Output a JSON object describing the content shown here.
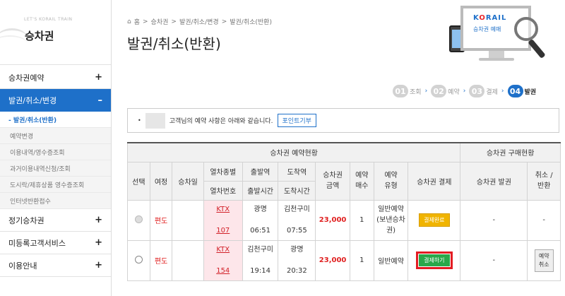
{
  "sidebar": {
    "tagline": "LET'S KORAIL TRAIN",
    "title": "승차권",
    "items": [
      {
        "label": "승차권예약",
        "mark": "+"
      },
      {
        "label": "발권/취소/변경",
        "mark": "–"
      },
      {
        "label": "정기승차권",
        "mark": "+"
      },
      {
        "label": "미등록고객서비스",
        "mark": "+"
      },
      {
        "label": "이용안내",
        "mark": "+"
      }
    ],
    "subitems": [
      {
        "label": "- 발권/취소(반환)"
      },
      {
        "label": "예약변경"
      },
      {
        "label": "이용내역/영수증조회"
      },
      {
        "label": "과거이용내역신청/조회"
      },
      {
        "label": "도시락/제휴상품 영수증조회"
      },
      {
        "label": "인터넷반환접수"
      }
    ]
  },
  "breadcrumb": [
    "홈",
    ">",
    "승차권",
    ">",
    "발권/취소/변경",
    ">",
    "발권/취소(반환)"
  ],
  "page_title": "발권/취소(반환)",
  "promo": {
    "logo_pre": "K",
    "logo_o": "O",
    "logo_post": "RAIL",
    "sub": "승차권 예매"
  },
  "steps": [
    {
      "num": "01",
      "label": "조회"
    },
    {
      "num": "02",
      "label": "예약"
    },
    {
      "num": "03",
      "label": "결제"
    },
    {
      "num": "04",
      "label": "발권"
    }
  ],
  "notice": {
    "text": "고객님의 예약 사항은 아래와 같습니다.",
    "button": "포인트기부"
  },
  "table": {
    "group_left": "승차권 예약현황",
    "group_right": "승차권 구매현황",
    "headers": {
      "select": "선택",
      "trip": "여정",
      "date": "승차일",
      "train_type": "열차종별",
      "train_no": "열차번호",
      "dep_station": "출발역",
      "dep_time": "출발시간",
      "arr_station": "도착역",
      "arr_time": "도착시간",
      "fare_1": "승차권",
      "fare_2": "금액",
      "count_1": "예약",
      "count_2": "매수",
      "type_1": "예약",
      "type_2": "유형",
      "pay": "승차권 결제",
      "issue": "승차권 발권",
      "cancel_1": "취소 /",
      "cancel_2": "반환"
    },
    "rows": [
      {
        "trip": "편도",
        "train_type": "KTX",
        "train_no": "107",
        "dep_station": "광명",
        "dep_time": "06:51",
        "arr_station": "김천구미",
        "arr_time": "07:55",
        "fare": "23,000",
        "count": "1",
        "type_1": "일반예약",
        "type_2": "(보낸승차",
        "type_3": "권)",
        "pay": "결제완료",
        "issue": "-",
        "cancel": "-"
      },
      {
        "trip": "편도",
        "train_type": "KTX",
        "train_no": "154",
        "dep_station": "김천구미",
        "dep_time": "19:14",
        "arr_station": "광명",
        "arr_time": "20:32",
        "fare": "23,000",
        "count": "1",
        "type_1": "일반예약",
        "pay": "결제하기",
        "issue": "-",
        "cancel_1": "예약",
        "cancel_2": "취소"
      }
    ]
  }
}
